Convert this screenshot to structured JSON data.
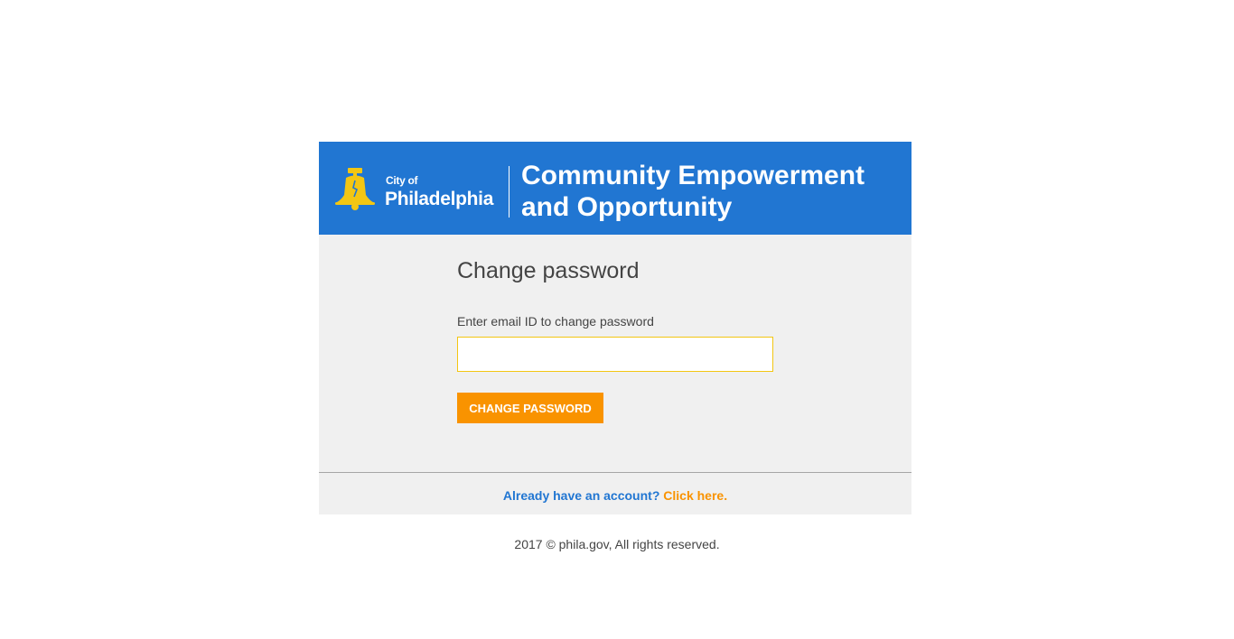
{
  "header": {
    "logo_city_of": "City of",
    "logo_city_name": "Philadelphia",
    "department_title": "Community Empowerment and Opportunity",
    "logo_icon": "liberty-bell-icon",
    "background_color": "#2176d2",
    "logo_color": "#f3c613"
  },
  "form": {
    "title": "Change password",
    "email_label": "Enter email ID to change password",
    "email_value": "",
    "email_placeholder": "",
    "submit_label": "CHANGE PASSWORD",
    "button_color": "#f99300"
  },
  "account_prompt": {
    "question": "Already have an account?",
    "link_text": "Click here."
  },
  "copyright": "2017 © phila.gov, All rights reserved."
}
